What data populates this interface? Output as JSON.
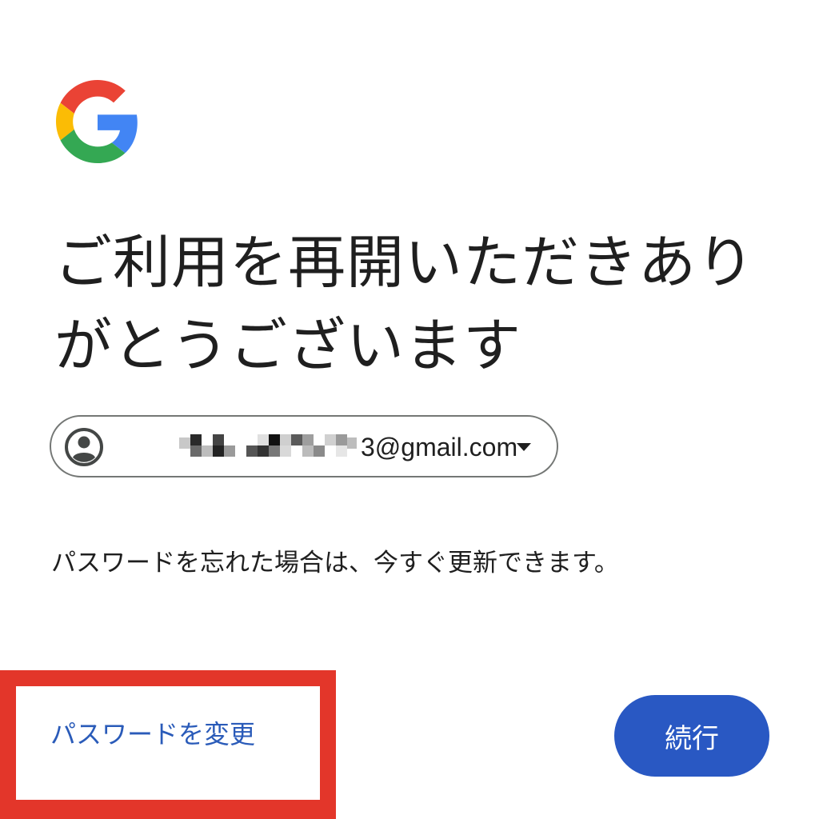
{
  "brand": {
    "logo_icon": "google-g-logo-icon",
    "colors": {
      "red": "#EA4335",
      "yellow": "#FBBC05",
      "green": "#34A853",
      "blue": "#4285F4"
    }
  },
  "heading": {
    "title": "ご利用を再開いただきありがとうございます"
  },
  "account": {
    "avatar_icon": "account-circle-icon",
    "email_visible_suffix": "3@gmail.com",
    "dropdown_icon": "caret-down-icon"
  },
  "info_text": "パスワードを忘れた場合は、今すぐ更新できます。",
  "actions": {
    "change_password_label": "パスワードを変更",
    "continue_label": "続行"
  },
  "colors": {
    "link": "#2a5bb9",
    "primary_button": "#2958c3",
    "highlight_border": "#e3362a"
  }
}
